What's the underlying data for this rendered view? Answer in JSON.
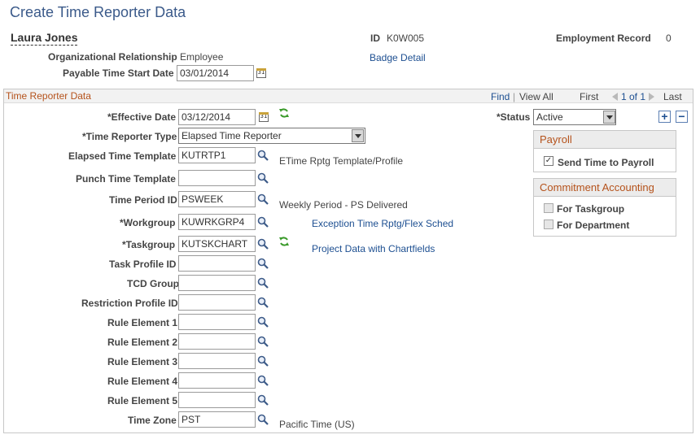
{
  "page": {
    "title": "Create Time Reporter Data"
  },
  "header": {
    "employee_name": "Laura Jones",
    "id_label": "ID",
    "id_value": "K0W005",
    "employment_record_label": "Employment Record",
    "employment_record_value": "0",
    "org_relationship_label": "Organizational Relationship",
    "org_relationship_value": "Employee",
    "badge_detail_link": "Badge Detail",
    "payable_start_label": "Payable Time Start Date",
    "payable_start_value": "03/01/2014"
  },
  "group": {
    "title": "Time Reporter Data",
    "find": "Find",
    "separator": "|",
    "view_all": "View All",
    "first": "First",
    "count": "1 of 1",
    "last": "Last"
  },
  "form": {
    "effective_date_label": "*Effective Date",
    "effective_date_value": "03/12/2014",
    "status_label": "*Status",
    "status_value": "Active",
    "reporter_type_label": "*Time Reporter Type",
    "reporter_type_value": "Elapsed Time Reporter",
    "elapsed_template_label": "Elapsed Time Template",
    "elapsed_template_value": "KUTRTP1",
    "elapsed_template_desc": "ETime Rptg Template/Profile",
    "punch_template_label": "Punch Time Template",
    "punch_template_value": "",
    "time_period_label": "Time Period ID",
    "time_period_value": "PSWEEK",
    "time_period_desc": "Weekly Period - PS Delivered",
    "workgroup_label": "*Workgroup",
    "workgroup_value": "KUWRKGRP4",
    "workgroup_desc": "Exception Time Rptg/Flex Sched",
    "taskgroup_label": "*Taskgroup",
    "taskgroup_value": "KUTSKCHART",
    "taskgroup_desc": "Project Data with Chartfields",
    "task_profile_label": "Task Profile ID",
    "task_profile_value": "",
    "tcd_group_label": "TCD Group",
    "tcd_group_value": "",
    "restriction_profile_label": "Restriction Profile ID",
    "restriction_profile_value": "",
    "rule_element_1_label": "Rule Element 1",
    "rule_element_1_value": "",
    "rule_element_2_label": "Rule Element 2",
    "rule_element_2_value": "",
    "rule_element_3_label": "Rule Element 3",
    "rule_element_3_value": "",
    "rule_element_4_label": "Rule Element 4",
    "rule_element_4_value": "",
    "rule_element_5_label": "Rule Element 5",
    "rule_element_5_value": "",
    "time_zone_label": "Time Zone",
    "time_zone_value": "PST",
    "time_zone_desc": "Pacific Time (US)"
  },
  "payroll": {
    "title": "Payroll",
    "send_time_label": "Send Time to Payroll",
    "send_time_checked": true
  },
  "commitment": {
    "title": "Commitment Accounting",
    "for_taskgroup_label": "For Taskgroup",
    "for_department_label": "For Department"
  },
  "icons": {
    "calendar": "calendar-icon",
    "lookup": "magnifier-icon",
    "refresh": "refresh-icon",
    "add": "plus-icon",
    "delete": "minus-icon"
  },
  "colors": {
    "title": "#3b5a8a",
    "group_title": "#b5521b",
    "link": "#1d4f91",
    "refresh": "#3a9a2a"
  }
}
